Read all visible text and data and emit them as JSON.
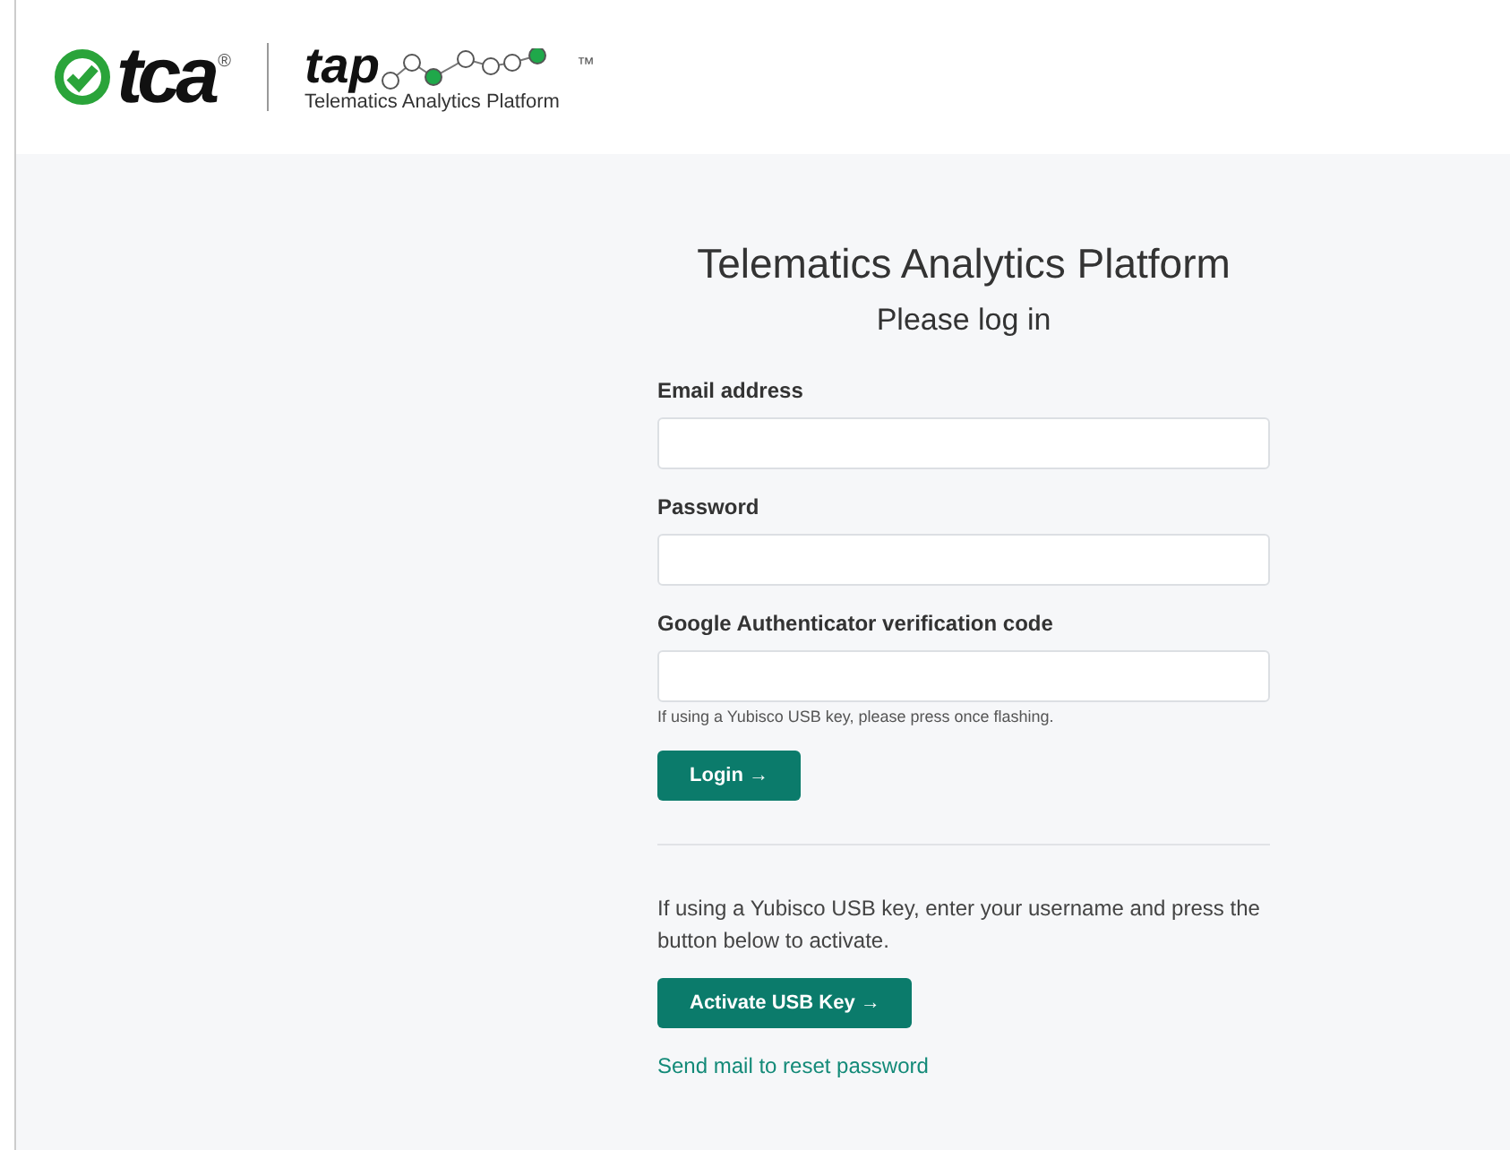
{
  "header": {
    "brand_logo": {
      "text": "tca",
      "mark": "®"
    },
    "product_logo": {
      "text": "tap",
      "mark": "™",
      "subtitle": "Telematics Analytics Platform"
    }
  },
  "login": {
    "title": "Telematics Analytics Platform",
    "subtitle": "Please log in",
    "fields": [
      {
        "label": "Email address"
      },
      {
        "label": "Password"
      },
      {
        "label": "Google Authenticator verification code",
        "hint": "If using a Yubisco USB key, please press once flashing."
      }
    ],
    "submit": "Login →",
    "usb_note": "If using a Yubisco USB key, enter your username and press the button below to activate.",
    "usb_button": "Activate USB Key →",
    "reset_link": "Send mail to reset password"
  }
}
